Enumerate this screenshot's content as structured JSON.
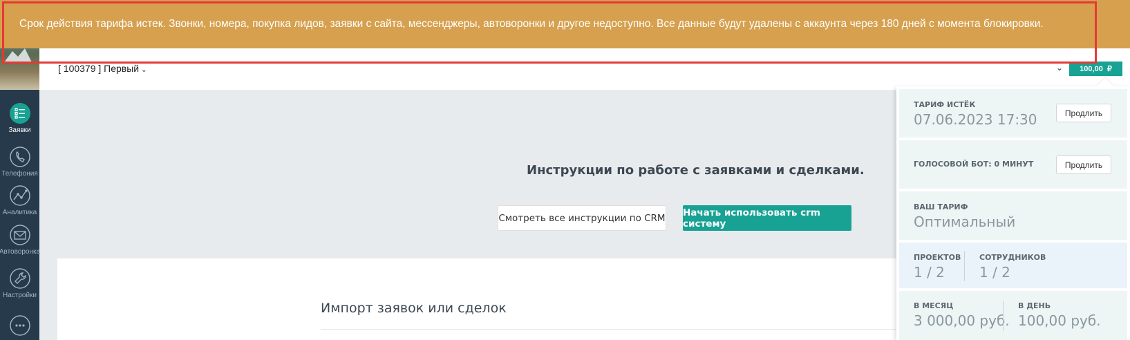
{
  "banner": {
    "text": "Срок действия тарифа истек. Звонки, номера, покупка лидов, заявки с сайта, мессенджеры, автоворонки и другое недоступно. Все данные будут удалены с аккаунта через 180 дней с момента блокировки."
  },
  "header": {
    "project": "[ 100379 ] Первый",
    "balance": "100,00",
    "currency": "₽"
  },
  "sidebar": {
    "items": [
      {
        "label": "Заявки",
        "icon": "list-icon",
        "active": true
      },
      {
        "label": "Телефония",
        "icon": "phone-icon",
        "active": false
      },
      {
        "label": "Аналитика",
        "icon": "analytics-icon",
        "active": false
      },
      {
        "label": "Автоворонка",
        "icon": "mail-icon",
        "active": false
      },
      {
        "label": "Настройки",
        "icon": "wrench-icon",
        "active": false
      },
      {
        "label": "",
        "icon": "chat-icon",
        "active": false
      }
    ]
  },
  "main": {
    "title": "Инструкции по работе с заявками и сделками.",
    "btn_instructions": "Смотреть все инструкции по CRM",
    "btn_start": "Начать использовать crm систему",
    "import_title": "Импорт заявок или сделок"
  },
  "panel": {
    "tariff_expired_label": "ТАРИФ ИСТЁК",
    "tariff_expired_date": "07.06.2023 17:30",
    "prolong1": "Продлить",
    "voice_bot_label": "ГОЛОСОВОЙ БОТ: 0 МИНУТ",
    "prolong2": "Продлить",
    "your_tariff_label": "ВАШ ТАРИФ",
    "your_tariff_value": "Оптимальный",
    "projects_label": "ПРОЕКТОВ",
    "projects_value": "1 / 2",
    "employees_label": "СОТРУДНИКОВ",
    "employees_value": "1 / 2",
    "month_label": "В МЕСЯЦ",
    "month_value": "3 000,00 руб.",
    "day_label": "В ДЕНЬ",
    "day_value": "100,00 руб."
  },
  "colors": {
    "banner": "#d6a04f",
    "accent": "#17a293",
    "sidebar": "#263a4c",
    "alert_outline": "#e53935"
  }
}
